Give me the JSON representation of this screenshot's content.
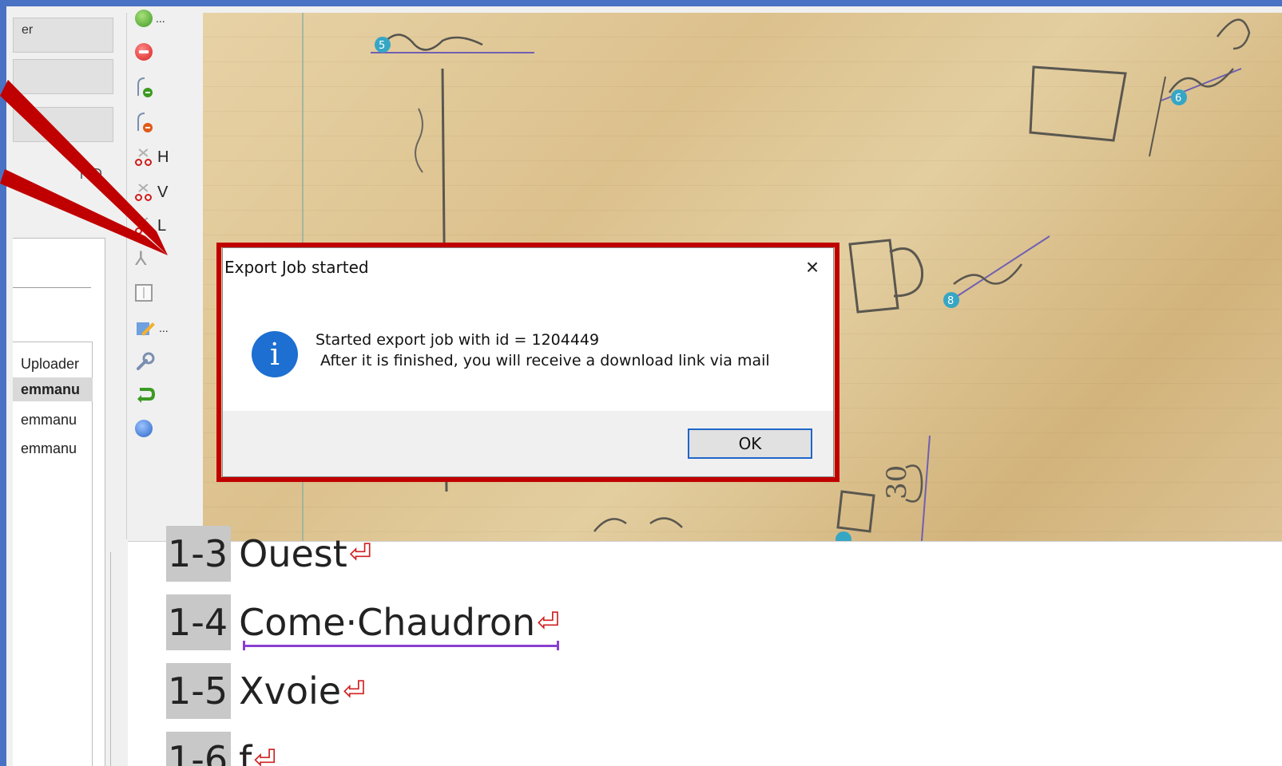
{
  "left_panel": {
    "btn_top_fragment": "er",
    "id_label": "l-ID",
    "column_header": "Uploader",
    "rows": [
      "emmanu",
      "emmanu",
      "emmanu"
    ]
  },
  "toolbar": {
    "h_label": "H",
    "v_label": "V",
    "l_label": "L",
    "more1": "...",
    "more2": "..."
  },
  "canvas": {
    "markers": [
      "5",
      "6",
      "8"
    ],
    "handwriting_number": "30"
  },
  "editor": {
    "lines": [
      {
        "num": "1-3",
        "text": "Ouest"
      },
      {
        "num": "1-4",
        "text": "Come·Chaudron"
      },
      {
        "num": "1-5",
        "text": "Xvoie"
      },
      {
        "num": "1-6",
        "text": "f"
      }
    ]
  },
  "dialog": {
    "title": "Export Job started",
    "close_icon": "×",
    "info_glyph": "i",
    "message_line1": "Started export job with id = 1204449",
    "message_line2": "After it is finished, you will receive a download link via mail",
    "ok_label": "OK"
  },
  "colors": {
    "frame_border": "#4a72c4",
    "callout_red": "#c00000",
    "info_blue": "#1d6fd1",
    "underline_purple": "#8a3fd0"
  }
}
